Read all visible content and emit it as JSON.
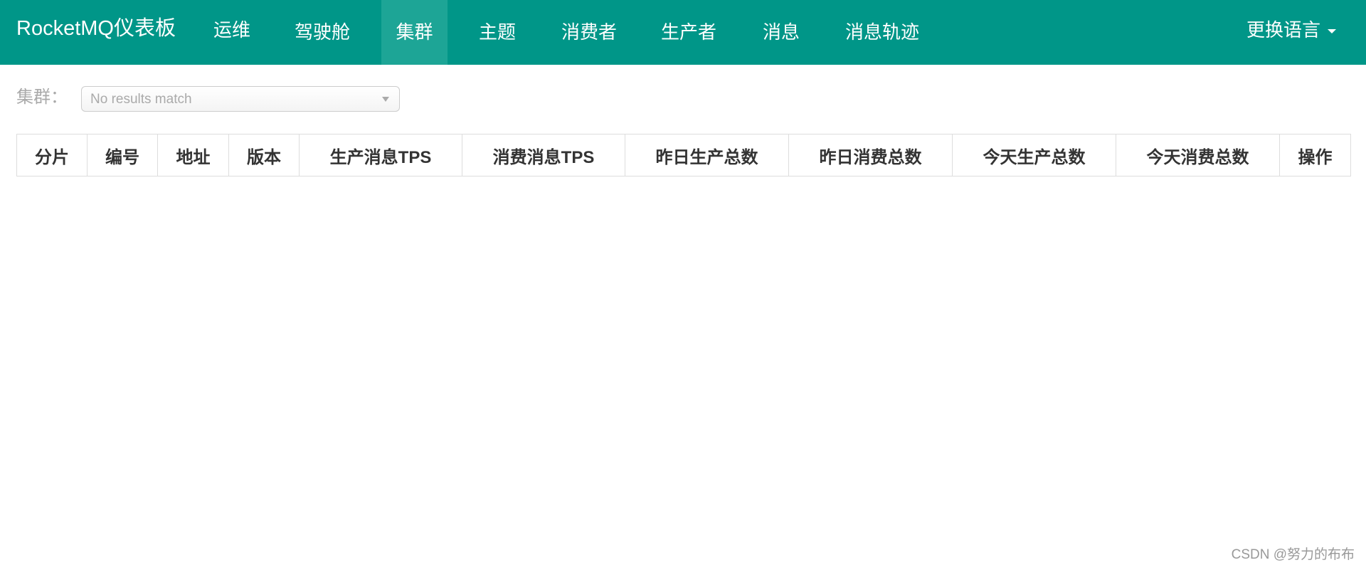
{
  "navbar": {
    "brand": "RocketMQ仪表板",
    "items": [
      {
        "label": "运维"
      },
      {
        "label": "驾驶舱"
      },
      {
        "label": "集群"
      },
      {
        "label": "主题"
      },
      {
        "label": "消费者"
      },
      {
        "label": "生产者"
      },
      {
        "label": "消息"
      },
      {
        "label": "消息轨迹"
      }
    ],
    "active": "集群",
    "language_label": "更换语言",
    "background_color": "#009688",
    "active_color": "#1da596"
  },
  "filter": {
    "label": "集群：",
    "select_text": "No results match"
  },
  "table": {
    "headers": [
      "分片",
      "编号",
      "地址",
      "版本",
      "生产消息TPS",
      "消费消息TPS",
      "昨日生产总数",
      "昨日消费总数",
      "今天生产总数",
      "今天消费总数",
      "操作"
    ],
    "rows": []
  },
  "watermark": "CSDN @努力的布布"
}
